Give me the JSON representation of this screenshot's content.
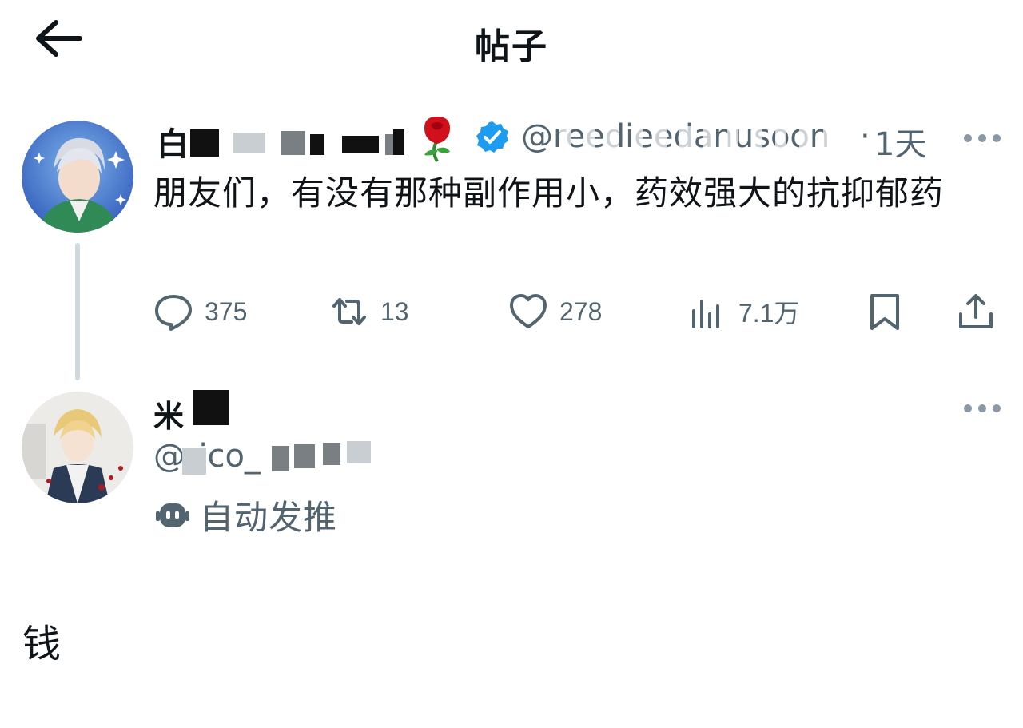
{
  "header": {
    "title": "帖子",
    "back_icon": "arrow-left-icon"
  },
  "post": {
    "author_name_visible": "白",
    "handle": "@reedieedanusoon",
    "separator": "·",
    "time": "1天",
    "text": "朋友们，有没有那种副作用小，药效强大的抗抑郁药",
    "emoji": "rose",
    "verified_color": "#1d9bf0",
    "stats": {
      "replies": "375",
      "retweets": "13",
      "likes": "278",
      "views": "7.1万"
    }
  },
  "reply": {
    "author_name_visible": "米",
    "handle": "@rico_",
    "automated_label": "自动发推"
  },
  "caption": "钱",
  "colors": {
    "text": "#0f1419",
    "muted": "#536471",
    "thread_line": "#cfd9de",
    "accent": "#1d9bf0"
  }
}
